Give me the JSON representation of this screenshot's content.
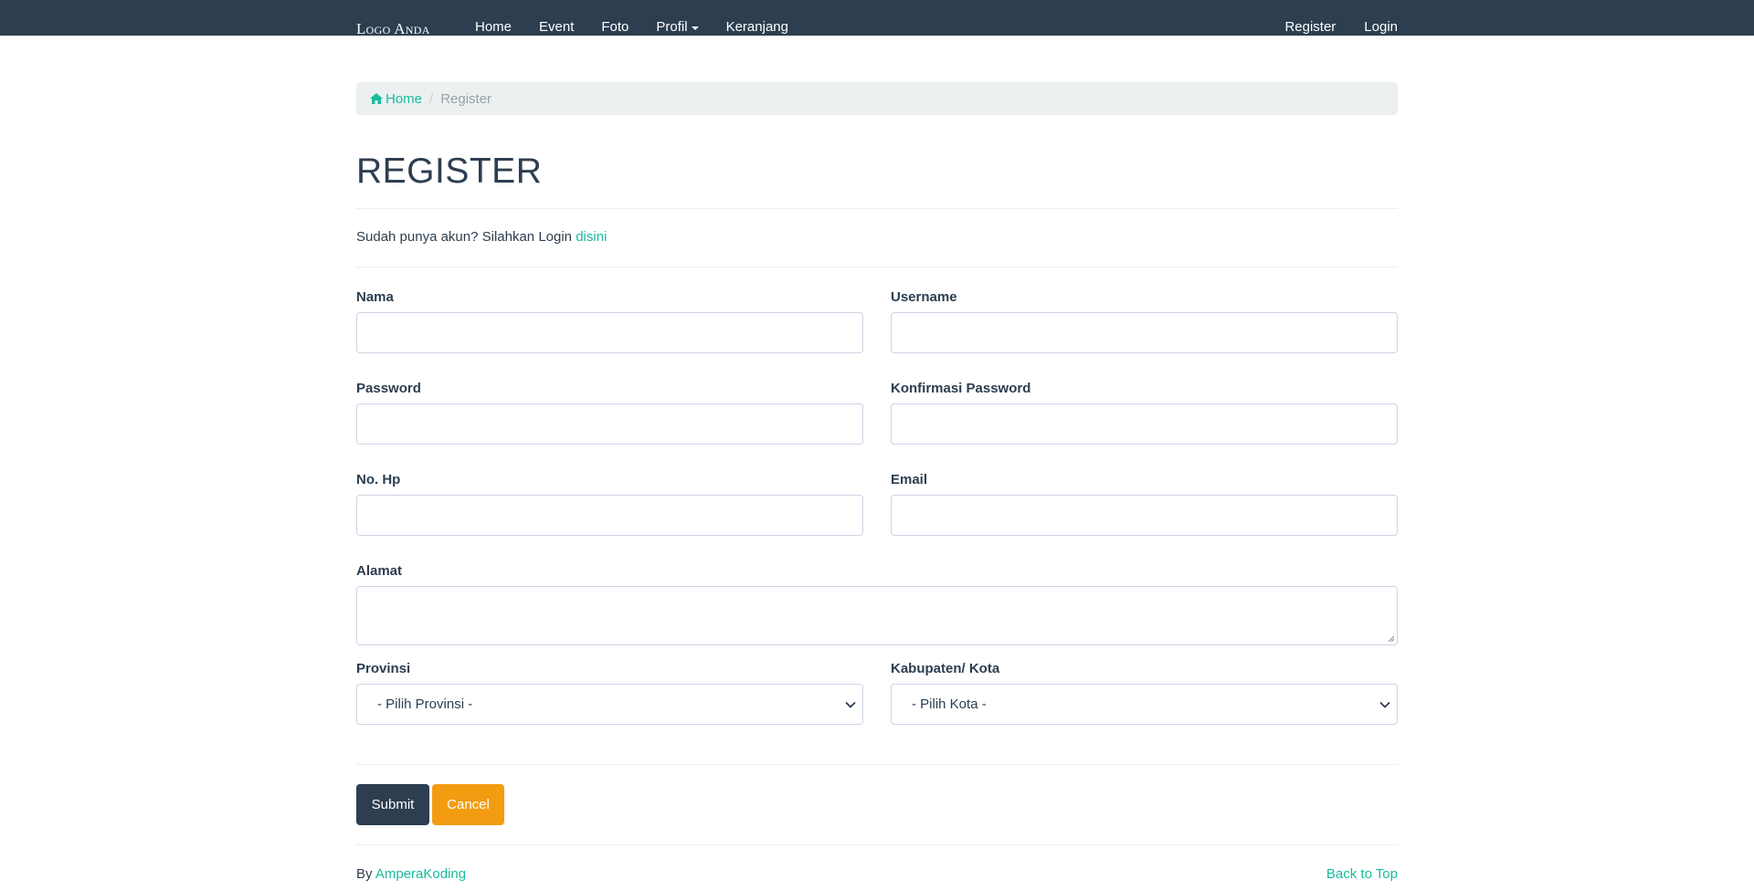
{
  "navbar": {
    "brand": "Logo Anda",
    "links": [
      "Home",
      "Event",
      "Foto",
      "Profil",
      "Keranjang"
    ],
    "right_links": [
      "Register",
      "Login"
    ]
  },
  "breadcrumb": {
    "home": "Home",
    "current": "Register"
  },
  "page": {
    "title": "REGISTER",
    "login_prompt": "Sudah punya akun? Silahkan Login",
    "login_link": "disini"
  },
  "form": {
    "nama_label": "Nama",
    "username_label": "Username",
    "password_label": "Password",
    "konfirmasi_label": "Konfirmasi Password",
    "nohp_label": "No. Hp",
    "email_label": "Email",
    "alamat_label": "Alamat",
    "provinsi_label": "Provinsi",
    "provinsi_value": "- Pilih Provinsi -",
    "kota_label": "Kabupaten/ Kota",
    "kota_value": "- Pilih Kota -",
    "submit": "Submit",
    "cancel": "Cancel"
  },
  "footer": {
    "by": "By",
    "author": "AmperaKoding",
    "back_to_top": "Back to Top"
  },
  "colors": {
    "navbar": "#2c3e50",
    "accent": "#18bc9c",
    "warning": "#f39c12",
    "text": "#2c3e50",
    "breadcrumb_bg": "#ecf0f1"
  }
}
